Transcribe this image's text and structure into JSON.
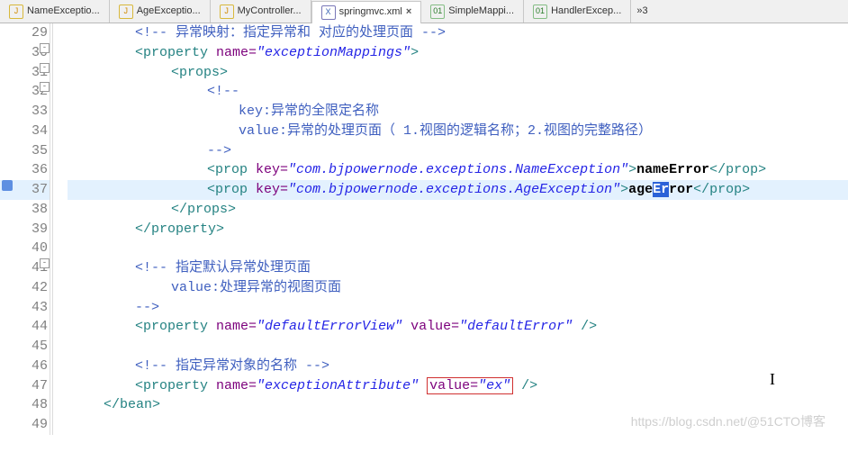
{
  "tabs": [
    {
      "icon": "J",
      "label": "NameExceptio...",
      "active": false,
      "iconClass": "j"
    },
    {
      "icon": "J",
      "label": "AgeExceptio...",
      "active": false,
      "iconClass": "j"
    },
    {
      "icon": "J",
      "label": "MyController...",
      "active": false,
      "iconClass": "j"
    },
    {
      "icon": "X",
      "label": "springmvc.xml",
      "active": true,
      "iconClass": "x"
    },
    {
      "icon": "01",
      "label": "SimpleMappi...",
      "active": false,
      "iconClass": "o"
    },
    {
      "icon": "01",
      "label": "HandlerExcep...",
      "active": false,
      "iconClass": "o"
    }
  ],
  "overflow_label": "»3",
  "line_numbers": [
    "29",
    "30",
    "31",
    "32",
    "33",
    "34",
    "35",
    "36",
    "37",
    "38",
    "39",
    "40",
    "41",
    "42",
    "43",
    "44",
    "45",
    "46",
    "47",
    "48",
    "49"
  ],
  "fold_lines": [
    "30",
    "31",
    "32",
    "41"
  ],
  "highlight_line": "37",
  "marked_line": "37",
  "c": {
    "l29": "<!-- 异常映射：指定异常和 对应的处理页面 -->",
    "l30_tag_open": "<property",
    "l30_attr": " name=",
    "l30_val": "\"exceptionMappings\"",
    "l30_close": ">",
    "l31": "<props>",
    "l32": "<!--",
    "l33": "key:异常的全限定名称",
    "l34": "value:异常的处理页面（ 1.视图的逻辑名称；2.视图的完整路径）",
    "l35": "-->",
    "prop": "<prop",
    "key": " key=",
    "end": ">",
    "cprop": "</prop>",
    "cprops": "</props>",
    "cproperty": "</property>",
    "l36k": "\"com.bjpowernode.exceptions.NameException\"",
    "l36t": "nameError",
    "l37k": "\"com.bjpowernode.exceptions.AgeException\"",
    "l37t_a": "age",
    "l37t_b": "Er",
    "l37t_c": "ror",
    "l41a": "<!-- 指定默认异常处理页面",
    "l42": "value:处理异常的视图页面",
    "l43": "-->",
    "name": "name=",
    "value": "value=",
    "slashend": " />",
    "l44name": "\"defaultErrorView\"",
    "l44val": "\"defaultError\"",
    "l46": "<!-- 指定异常对象的名称 -->",
    "l47name": "\"exceptionAttribute\"",
    "l47val": "\"ex\"",
    "l48": "</bean>"
  },
  "watermark": "https://blog.csdn.net/@51CTO博客"
}
